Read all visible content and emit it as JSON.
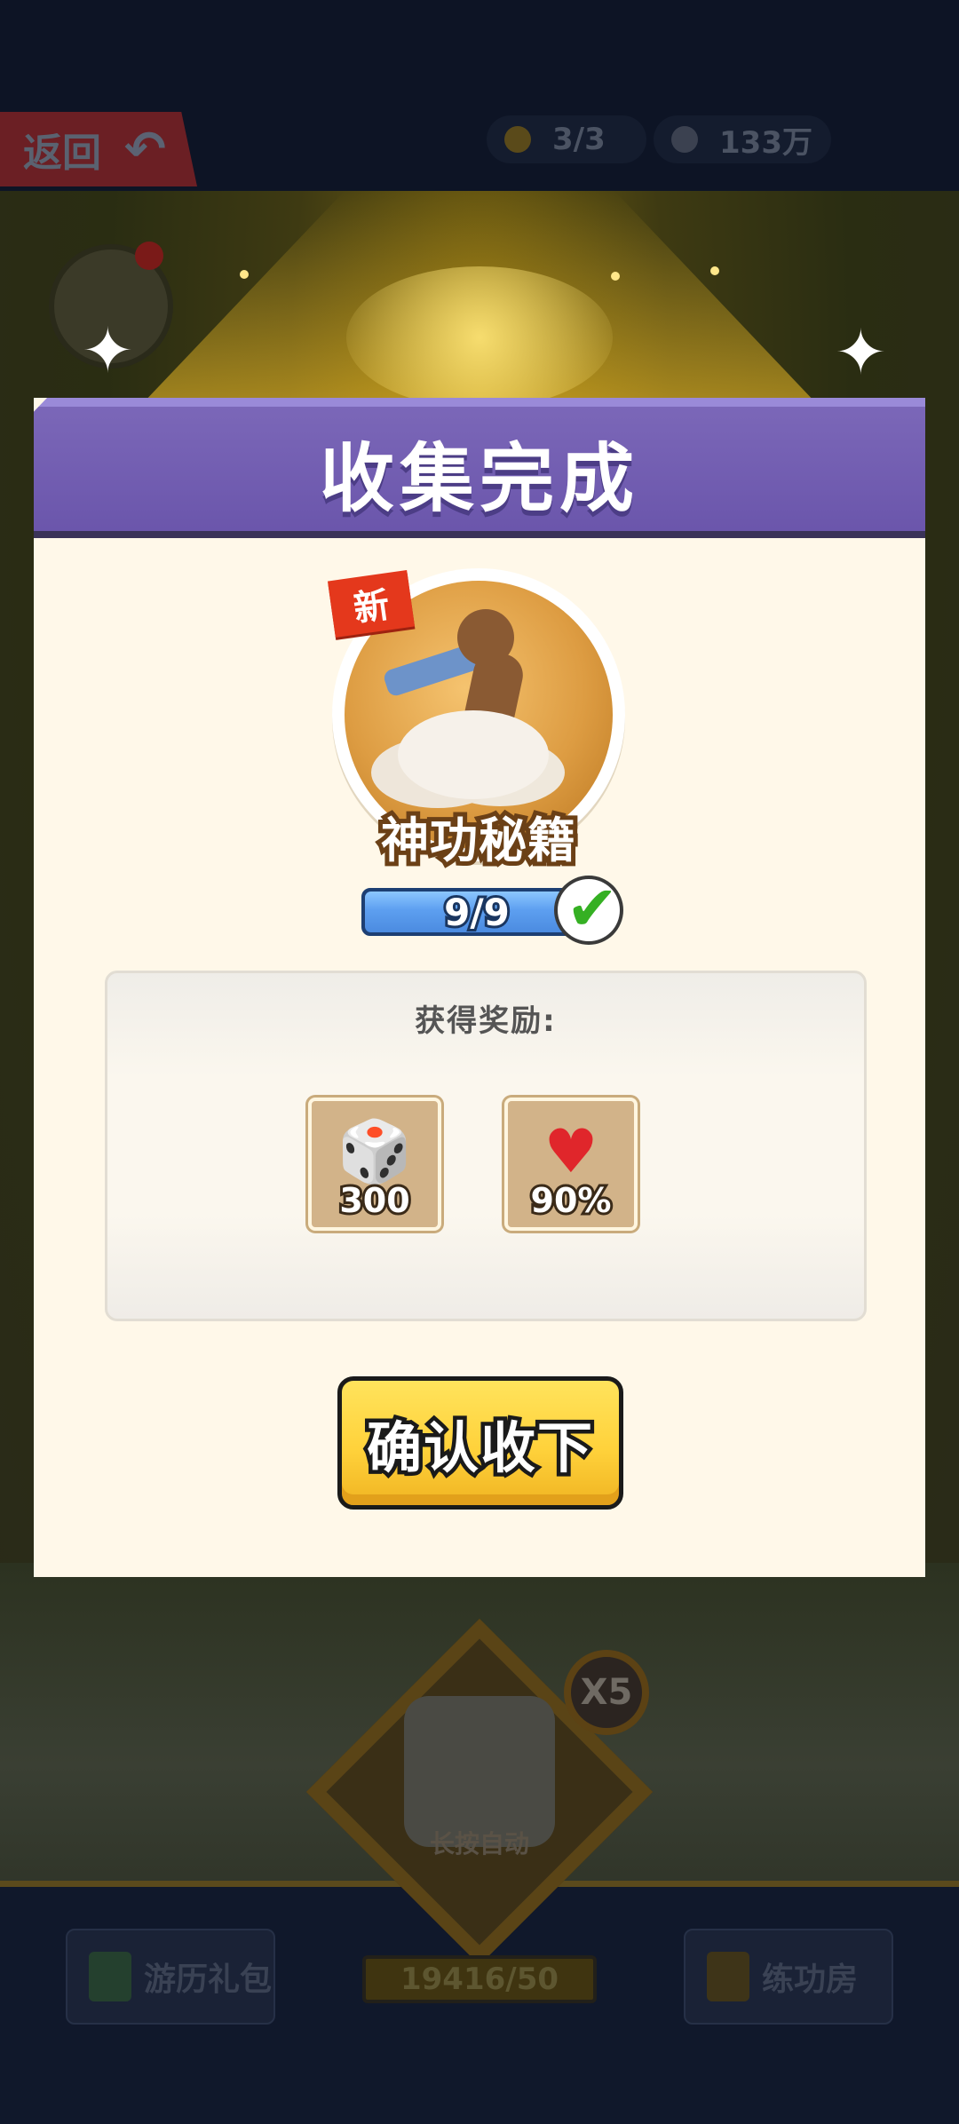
{
  "topbar": {
    "back_label": "返回",
    "stamina": "3/3",
    "coins": "133万"
  },
  "modal": {
    "title": "收集完成",
    "new_tag": "新",
    "item_name": "神功秘籍",
    "progress_text": "9/9",
    "progress_fraction": 1.0,
    "reward_title": "获得奖励:",
    "rewards": [
      {
        "icon": "dice-icon",
        "value": "300"
      },
      {
        "icon": "heart-icon",
        "value": "90%"
      }
    ],
    "confirm_label": "确认收下"
  },
  "background": {
    "dice_hint": "长按自动",
    "multiplier": "X5",
    "counter": "19416/50",
    "left_button": "游历礼包",
    "right_button": "练功房"
  },
  "colors": {
    "header_purple": "#6a55ab",
    "confirm_yellow": "#ffd23b",
    "progress_blue": "#5d9ff0",
    "check_green": "#35b023",
    "new_tag_red": "#e4381c"
  }
}
